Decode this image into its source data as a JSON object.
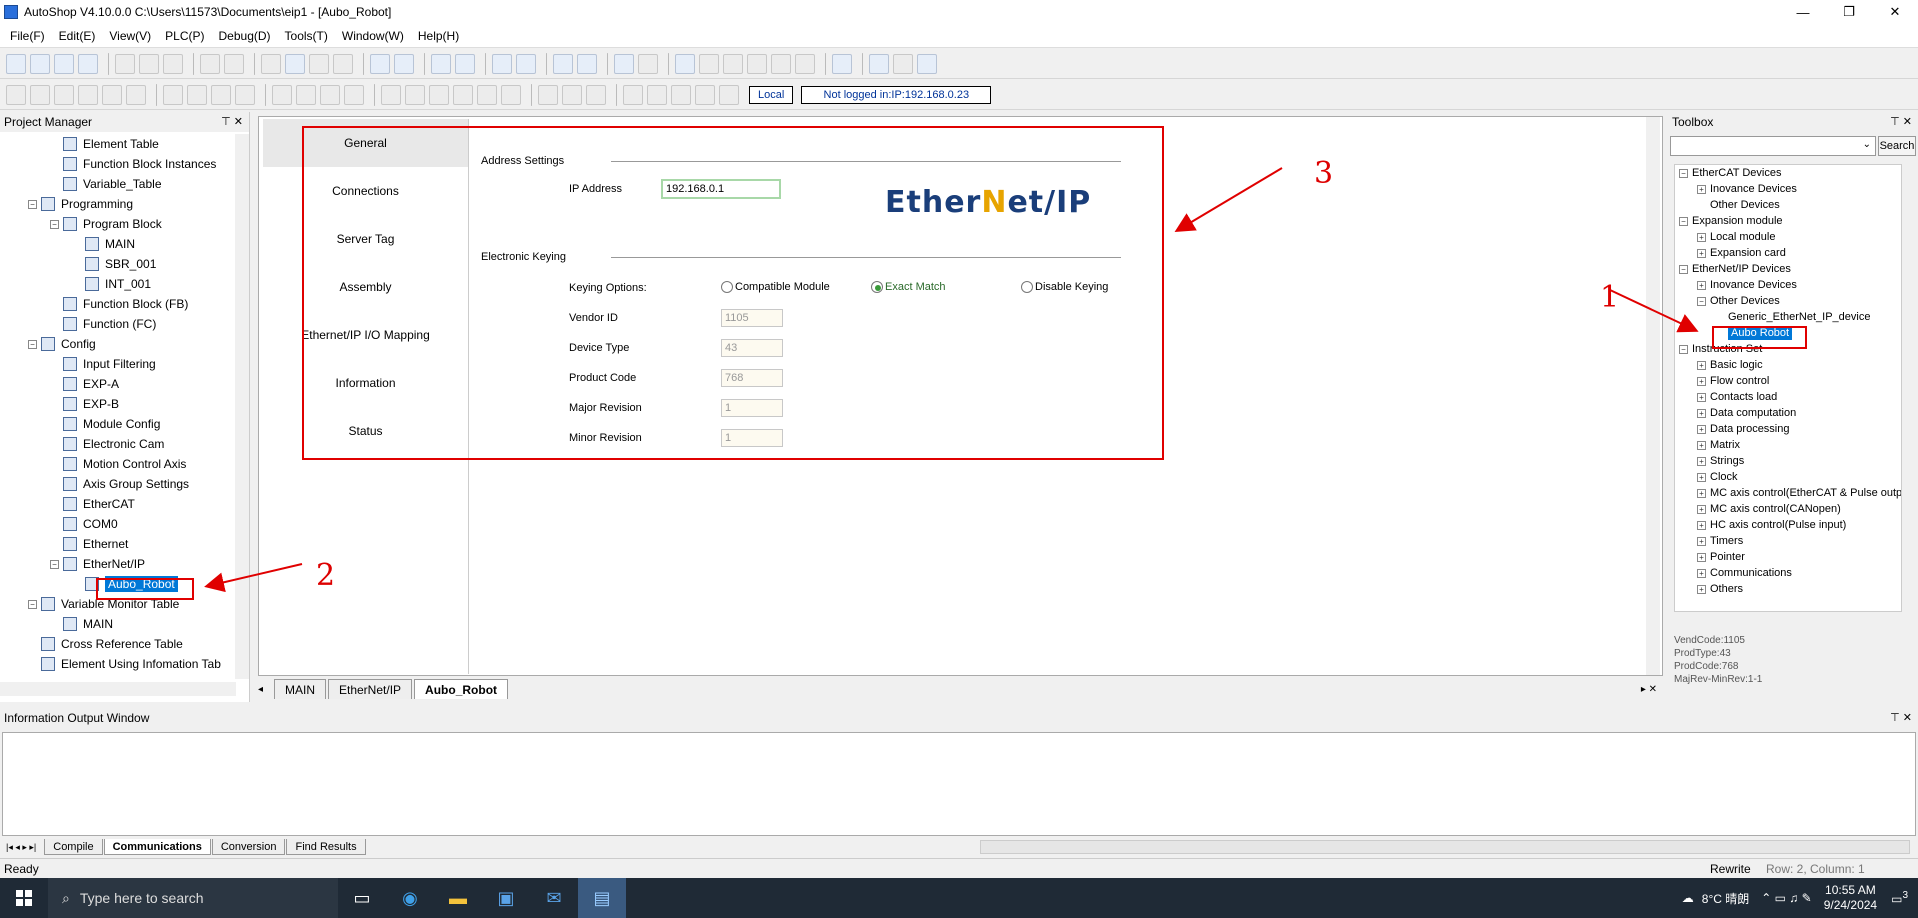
{
  "window": {
    "title": "AutoShop V4.10.0.0  C:\\Users\\11573\\Documents\\eip1 - [Aubo_Robot]",
    "controls": [
      "—",
      "❐",
      "✕"
    ]
  },
  "menu": [
    "File(F)",
    "Edit(E)",
    "View(V)",
    "PLC(P)",
    "Debug(D)",
    "Tools(T)",
    "Window(W)",
    "Help(H)"
  ],
  "toolbar": {
    "local_label": "Local",
    "connection_status": "Not logged in:IP:192.168.0.23"
  },
  "project_manager": {
    "title": "Project Manager",
    "items": [
      {
        "label": "Element Table",
        "level": 2,
        "exp": ""
      },
      {
        "label": "Function Block Instances",
        "level": 2,
        "exp": ""
      },
      {
        "label": "Variable_Table",
        "level": 2,
        "exp": ""
      },
      {
        "label": "Programming",
        "level": 1,
        "exp": "−"
      },
      {
        "label": "Program Block",
        "level": 2,
        "exp": "−"
      },
      {
        "label": "MAIN",
        "level": 3,
        "exp": ""
      },
      {
        "label": "SBR_001",
        "level": 3,
        "exp": ""
      },
      {
        "label": "INT_001",
        "level": 3,
        "exp": ""
      },
      {
        "label": "Function Block (FB)",
        "level": 2,
        "exp": ""
      },
      {
        "label": "Function (FC)",
        "level": 2,
        "exp": ""
      },
      {
        "label": "Config",
        "level": 1,
        "exp": "−"
      },
      {
        "label": "Input Filtering",
        "level": 2,
        "exp": ""
      },
      {
        "label": "EXP-A",
        "level": 2,
        "exp": ""
      },
      {
        "label": "EXP-B",
        "level": 2,
        "exp": ""
      },
      {
        "label": "Module Config",
        "level": 2,
        "exp": ""
      },
      {
        "label": "Electronic Cam",
        "level": 2,
        "exp": ""
      },
      {
        "label": "Motion Control Axis",
        "level": 2,
        "exp": ""
      },
      {
        "label": "Axis Group Settings",
        "level": 2,
        "exp": ""
      },
      {
        "label": "EtherCAT",
        "level": 2,
        "exp": ""
      },
      {
        "label": "COM0",
        "level": 2,
        "exp": ""
      },
      {
        "label": "Ethernet",
        "level": 2,
        "exp": ""
      },
      {
        "label": "EtherNet/IP",
        "level": 2,
        "exp": "−"
      },
      {
        "label": "Aubo_Robot",
        "level": 3,
        "exp": "",
        "selected": true
      },
      {
        "label": "Variable Monitor Table",
        "level": 1,
        "exp": "−"
      },
      {
        "label": "MAIN",
        "level": 2,
        "exp": ""
      },
      {
        "label": "Cross Reference Table",
        "level": 1,
        "exp": ""
      },
      {
        "label": "Element Using Infomation Tab",
        "level": 1,
        "exp": ""
      }
    ]
  },
  "editor": {
    "side_tabs": [
      "General",
      "Connections",
      "Server Tag",
      "Assembly",
      "Ethernet/IP I/O Mapping",
      "Information",
      "Status"
    ],
    "address_settings": "Address Settings",
    "ip_label": "IP Address",
    "ip_value": "192.168.0.1",
    "logo_left": "Ether",
    "logo_star": "N",
    "logo_right": "et/IP",
    "electronic_keying": "Electronic Keying",
    "keying_label": "Keying Options:",
    "keying_options": [
      "Compatible Module",
      "Exact Match",
      "Disable Keying"
    ],
    "keying_selected": 1,
    "fields": [
      {
        "label": "Vendor ID",
        "value": "1105"
      },
      {
        "label": "Device Type",
        "value": "43"
      },
      {
        "label": "Product Code",
        "value": "768"
      },
      {
        "label": "Major Revision",
        "value": "1"
      },
      {
        "label": "Minor Revision",
        "value": "1"
      }
    ]
  },
  "doc_tabs": [
    "MAIN",
    "EtherNet/IP",
    "Aubo_Robot"
  ],
  "toolbox": {
    "title": "Toolbox",
    "search_label": "Search",
    "items": [
      {
        "label": "EtherCAT Devices",
        "level": 0,
        "exp": "−"
      },
      {
        "label": "Inovance Devices",
        "level": 1,
        "exp": "+"
      },
      {
        "label": "Other Devices",
        "level": 1,
        "exp": ""
      },
      {
        "label": "Expansion module",
        "level": 0,
        "exp": "−"
      },
      {
        "label": "Local module",
        "level": 1,
        "exp": "+"
      },
      {
        "label": "Expansion card",
        "level": 1,
        "exp": "+"
      },
      {
        "label": "EtherNet/IP Devices",
        "level": 0,
        "exp": "−"
      },
      {
        "label": "Inovance Devices",
        "level": 1,
        "exp": "+"
      },
      {
        "label": "Other Devices",
        "level": 1,
        "exp": "−"
      },
      {
        "label": "Generic_EtherNet_IP_device",
        "level": 2,
        "exp": ""
      },
      {
        "label": "Aubo Robot",
        "level": 2,
        "exp": "",
        "selected": true
      },
      {
        "label": "Instruction Set",
        "level": 0,
        "exp": "−"
      },
      {
        "label": "Basic logic",
        "level": 1,
        "exp": "+"
      },
      {
        "label": "Flow control",
        "level": 1,
        "exp": "+"
      },
      {
        "label": "Contacts load",
        "level": 1,
        "exp": "+"
      },
      {
        "label": "Data computation",
        "level": 1,
        "exp": "+"
      },
      {
        "label": "Data processing",
        "level": 1,
        "exp": "+"
      },
      {
        "label": "Matrix",
        "level": 1,
        "exp": "+"
      },
      {
        "label": "Strings",
        "level": 1,
        "exp": "+"
      },
      {
        "label": "Clock",
        "level": 1,
        "exp": "+"
      },
      {
        "label": "MC axis control(EtherCAT & Pulse outp",
        "level": 1,
        "exp": "+"
      },
      {
        "label": "MC axis control(CANopen)",
        "level": 1,
        "exp": "+"
      },
      {
        "label": "HC axis control(Pulse input)",
        "level": 1,
        "exp": "+"
      },
      {
        "label": "Timers",
        "level": 1,
        "exp": "+"
      },
      {
        "label": "Pointer",
        "level": 1,
        "exp": "+"
      },
      {
        "label": "Communications",
        "level": 1,
        "exp": "+"
      },
      {
        "label": "Others",
        "level": 1,
        "exp": "+"
      }
    ],
    "info_lines": [
      "VendCode:1105",
      "ProdType:43",
      "ProdCode:768",
      "MajRev-MinRev:1-1"
    ]
  },
  "info_window": {
    "title": "Information Output Window",
    "tabs": [
      "Compile",
      "Communications",
      "Conversion",
      "Find Results"
    ],
    "active_tab": 1
  },
  "status_bar": {
    "left": "Ready",
    "mode": "Rewrite",
    "position": "Row:  2, Column:  1"
  },
  "annotations": [
    "1",
    "2",
    "3"
  ],
  "taskbar": {
    "search_placeholder": "Type here to search",
    "weather": "8°C 晴朗",
    "time": "10:55 AM",
    "date": "9/24/2024",
    "notifications": "3"
  },
  "colors": {
    "selection": "#0078d7",
    "annotation_red": "#e00000",
    "logo_blue": "#1a3e7a",
    "logo_gold": "#e7a400"
  }
}
